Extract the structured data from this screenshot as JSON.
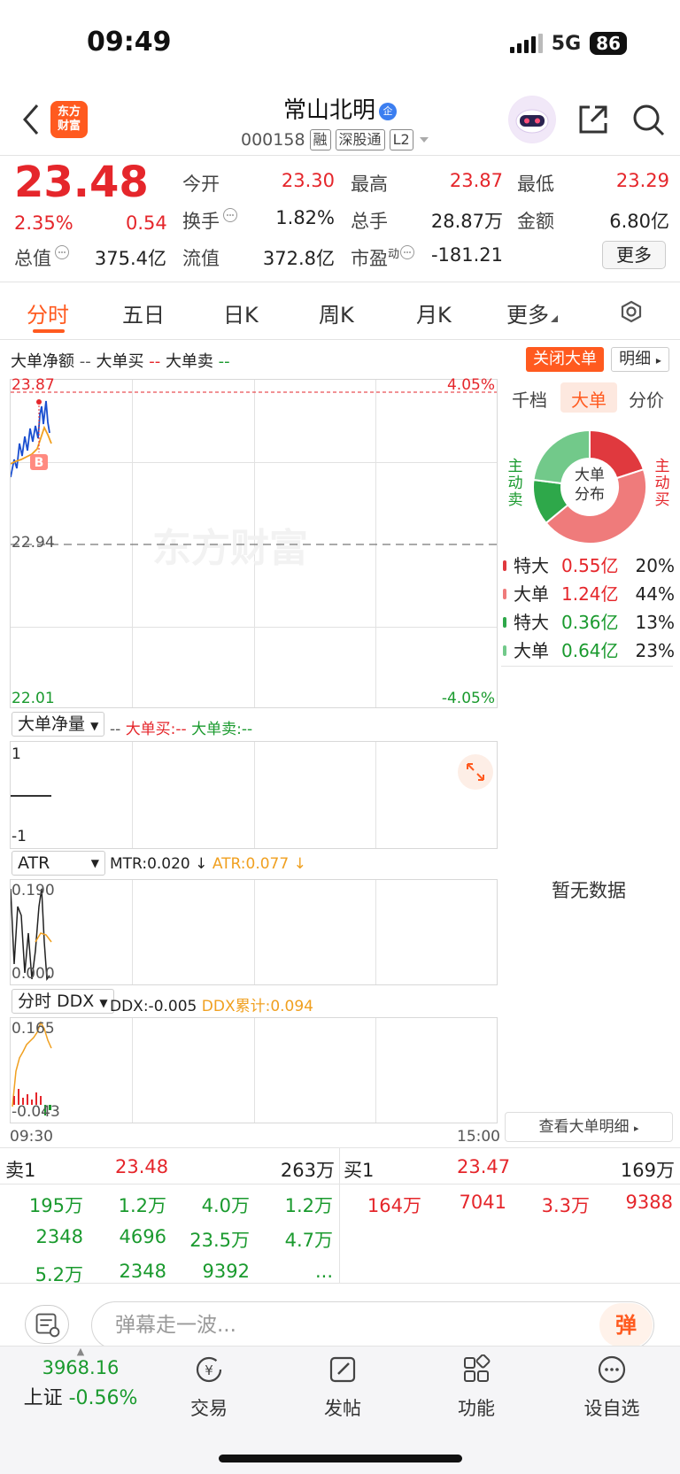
{
  "status_bar": {
    "time": "09:49",
    "network": "5G",
    "battery": "86"
  },
  "nav": {
    "logo_line1": "东方",
    "logo_line2": "财富",
    "stock_name": "常山北明",
    "name_badge": "企",
    "code": "000158",
    "tags": [
      "融",
      "深股通",
      "L2"
    ]
  },
  "quote": {
    "price": "23.48",
    "pct": "2.35%",
    "change": "0.54",
    "rows": [
      [
        {
          "label": "今开",
          "value": "23.30",
          "color": "red"
        },
        {
          "label": "最高",
          "value": "23.87",
          "color": "red"
        },
        {
          "label": "最低",
          "value": "23.29",
          "color": "red"
        }
      ],
      [
        {
          "label": "换手",
          "value": "1.82%",
          "color": "black"
        },
        {
          "label": "总手",
          "value": "28.87万",
          "color": "black"
        },
        {
          "label": "金额",
          "value": "6.80亿",
          "color": "black"
        }
      ],
      [
        {
          "label": "总值",
          "value": "375.4亿",
          "color": "black"
        },
        {
          "label": "流值",
          "value": "372.8亿",
          "color": "black"
        },
        {
          "label": "市盈",
          "sup": "动",
          "value": "-181.21",
          "color": "black"
        }
      ]
    ],
    "more_label": "更多"
  },
  "tabs": [
    "分时",
    "五日",
    "日K",
    "周K",
    "月K",
    "更多"
  ],
  "indicator_header": {
    "net": "大单净额",
    "net_val": "--",
    "buy": "大单买",
    "buy_val": "--",
    "sell": "大单卖",
    "sell_val": "--",
    "close_btn": "关闭大单",
    "detail_btn": "明细"
  },
  "main_chart": {
    "price_high": "23.87",
    "pct_high": "4.05%",
    "price_mid": "22.94",
    "price_low": "22.01",
    "pct_low": "-4.05%",
    "marker": "B",
    "watermark": "东方财富",
    "time_start": "09:30",
    "time_end": "15:00"
  },
  "vol_panel": {
    "selector": "大单净量",
    "val": "--",
    "buy": "大单买:--",
    "sell": "大单卖:--",
    "top": "1",
    "bottom": "-1"
  },
  "atr_panel": {
    "selector": "ATR",
    "mtr": "MTR:0.020",
    "atr": "ATR:0.077",
    "top": "0.190",
    "bottom": "0.000"
  },
  "ddx_panel": {
    "selector": "分时 DDX",
    "ddx": "DDX:-0.005",
    "ddx_cum": "DDX累计:0.094",
    "top": "0.165",
    "bottom": "-0.043"
  },
  "right_panel": {
    "tabs": [
      "千档",
      "大单",
      "分价"
    ],
    "donut_center": [
      "大单",
      "分布"
    ],
    "label_sell": [
      "主",
      "动",
      "卖"
    ],
    "label_buy": [
      "主",
      "动",
      "买"
    ],
    "rows": [
      {
        "label": "特大",
        "value": "0.55亿",
        "pct": "20%",
        "color": "#e0393e",
        "text": "red"
      },
      {
        "label": "大单",
        "value": "1.24亿",
        "pct": "44%",
        "color": "#ef7b7b",
        "text": "red"
      },
      {
        "label": "特大",
        "value": "0.36亿",
        "pct": "13%",
        "color": "#2ea84a",
        "text": "green"
      },
      {
        "label": "大单",
        "value": "0.64亿",
        "pct": "23%",
        "color": "#72c98a",
        "text": "green"
      }
    ],
    "no_data": "暂无数据",
    "view_detail": "查看大单明细"
  },
  "order_book": {
    "sell1_label": "卖1",
    "sell1_price": "23.48",
    "sell1_vol": "263万",
    "buy1_label": "买1",
    "buy1_price": "23.47",
    "buy1_vol": "169万",
    "sell_queue": [
      [
        "195万",
        "1.2万",
        "4.0万",
        "1.2万"
      ],
      [
        "2348",
        "4696",
        "23.5万",
        "4.7万"
      ],
      [
        "5.2万",
        "2348",
        "9392",
        "..."
      ]
    ],
    "buy_queue": [
      [
        "164万",
        "7041",
        "3.3万",
        "9388"
      ]
    ]
  },
  "comment": {
    "placeholder": "弹幕走一波...",
    "danmu": "弹"
  },
  "bottom_nav": {
    "index_value": "3968.16",
    "index_name": "上证",
    "index_change": "-0.56%",
    "items": [
      "交易",
      "发帖",
      "功能",
      "设自选"
    ]
  },
  "colors": {
    "accent": "#ff5a1f",
    "up": "#e5262b",
    "down": "#1a9a2e"
  }
}
